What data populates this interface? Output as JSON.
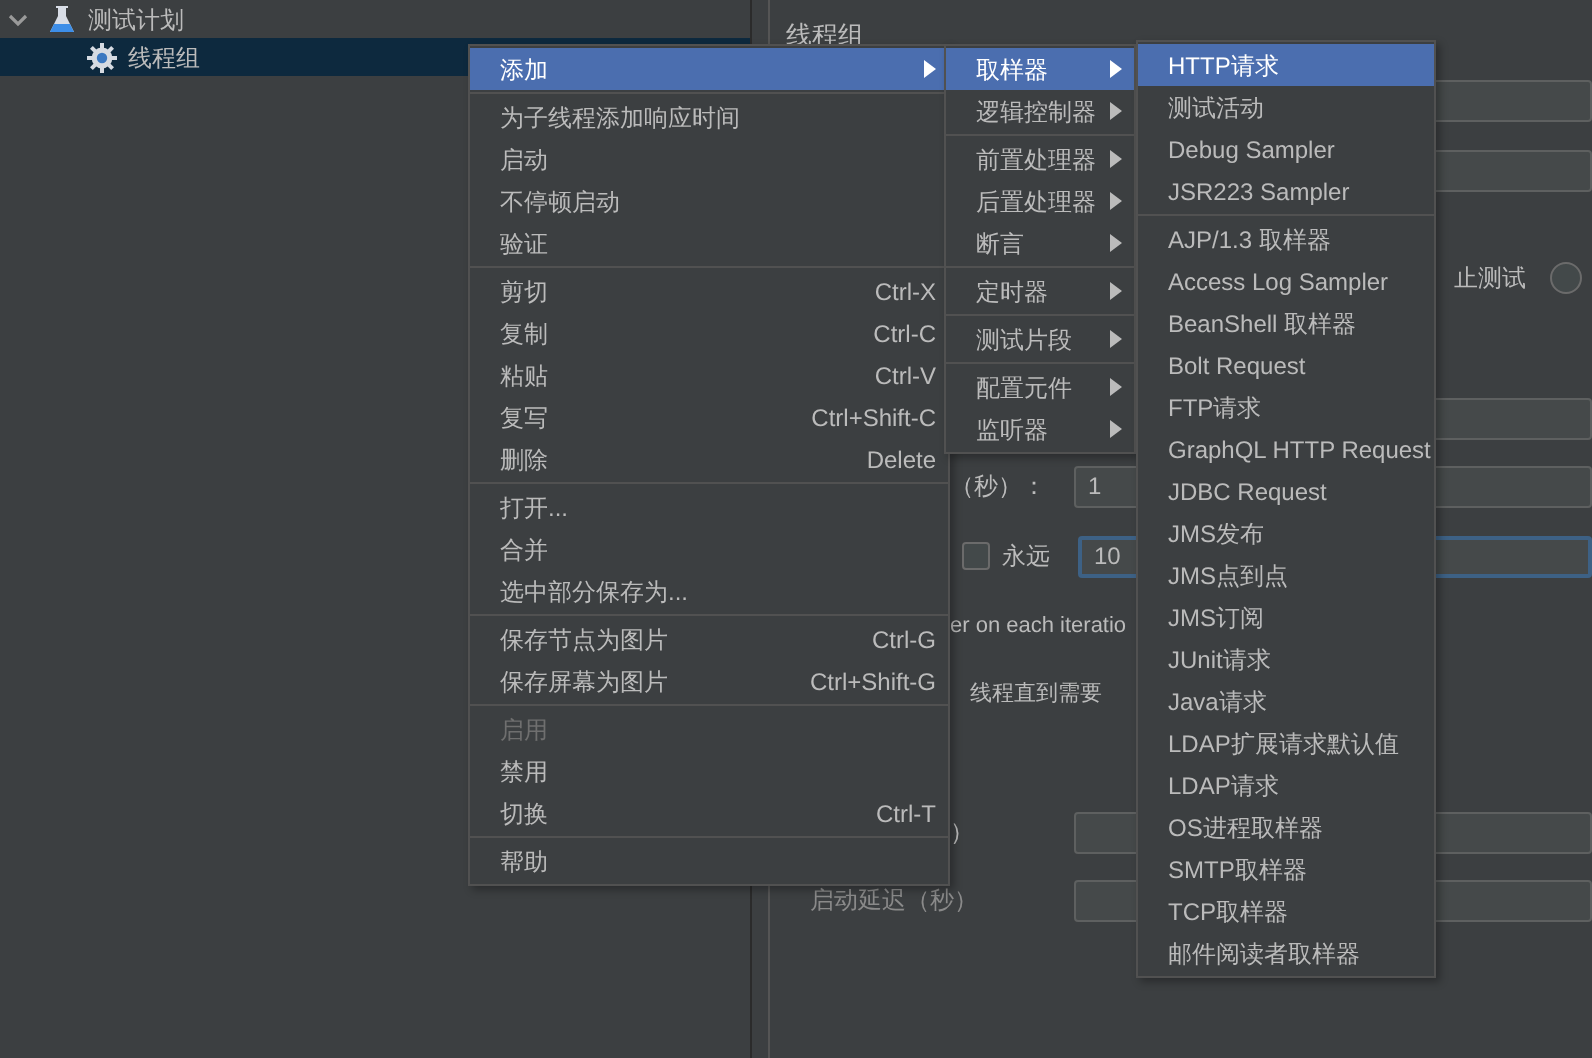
{
  "tree": [
    {
      "label": "测试计划",
      "kind": "test_plan",
      "expanded": true,
      "selected": false,
      "children": [
        {
          "label": "线程组",
          "kind": "thread_group",
          "selected": true
        }
      ]
    }
  ],
  "panel": {
    "title": "线程组",
    "rows": [
      {
        "kind": "field",
        "focused": false
      },
      {
        "kind": "field",
        "focused": false
      },
      {
        "kind": "radio",
        "text": "止测试",
        "checked": false
      },
      {
        "kind": "field",
        "focused": false
      },
      {
        "kind": "label_field",
        "label": "（秒）：",
        "value": "1",
        "focused": false
      },
      {
        "kind": "checkbox_field",
        "label": "永远",
        "checked": false,
        "value": "10",
        "focused": true
      },
      {
        "kind": "text",
        "text": "er on each iteratio"
      },
      {
        "kind": "text",
        "text": "线程直到需要"
      },
      {
        "kind": "label_field",
        "label": "）",
        "focused": false
      },
      {
        "kind": "label_field",
        "label": "启动延迟（秒）",
        "focused": false
      }
    ]
  },
  "context_menu": [
    {
      "kind": "item",
      "label": "添加",
      "submenu": true,
      "selected": true,
      "disabled": false
    },
    {
      "kind": "separator"
    },
    {
      "kind": "item",
      "label": "为子线程添加响应时间",
      "selected": false,
      "disabled": false
    },
    {
      "kind": "item",
      "label": "启动",
      "selected": false,
      "disabled": false
    },
    {
      "kind": "item",
      "label": "不停顿启动",
      "selected": false,
      "disabled": false
    },
    {
      "kind": "item",
      "label": "验证",
      "selected": false,
      "disabled": false
    },
    {
      "kind": "separator"
    },
    {
      "kind": "item",
      "label": "剪切",
      "shortcut": "Ctrl-X",
      "selected": false,
      "disabled": false
    },
    {
      "kind": "item",
      "label": "复制",
      "shortcut": "Ctrl-C",
      "selected": false,
      "disabled": false
    },
    {
      "kind": "item",
      "label": "粘贴",
      "shortcut": "Ctrl-V",
      "selected": false,
      "disabled": false
    },
    {
      "kind": "item",
      "label": "复写",
      "shortcut": "Ctrl+Shift-C",
      "selected": false,
      "disabled": false
    },
    {
      "kind": "item",
      "label": "删除",
      "shortcut": "Delete",
      "selected": false,
      "disabled": false
    },
    {
      "kind": "separator"
    },
    {
      "kind": "item",
      "label": "打开...",
      "selected": false,
      "disabled": false
    },
    {
      "kind": "item",
      "label": "合并",
      "selected": false,
      "disabled": false
    },
    {
      "kind": "item",
      "label": "选中部分保存为...",
      "selected": false,
      "disabled": false
    },
    {
      "kind": "separator"
    },
    {
      "kind": "item",
      "label": "保存节点为图片",
      "shortcut": "Ctrl-G",
      "selected": false,
      "disabled": false
    },
    {
      "kind": "item",
      "label": "保存屏幕为图片",
      "shortcut": "Ctrl+Shift-G",
      "selected": false,
      "disabled": false
    },
    {
      "kind": "separator"
    },
    {
      "kind": "item",
      "label": "启用",
      "selected": false,
      "disabled": true
    },
    {
      "kind": "item",
      "label": "禁用",
      "selected": false,
      "disabled": false
    },
    {
      "kind": "item",
      "label": "切换",
      "shortcut": "Ctrl-T",
      "selected": false,
      "disabled": false
    },
    {
      "kind": "separator"
    },
    {
      "kind": "item",
      "label": "帮助",
      "selected": false,
      "disabled": false
    }
  ],
  "add_menu": [
    {
      "kind": "item",
      "label": "取样器",
      "submenu": true,
      "selected": true
    },
    {
      "kind": "item",
      "label": "逻辑控制器",
      "submenu": true,
      "selected": false
    },
    {
      "kind": "separator"
    },
    {
      "kind": "item",
      "label": "前置处理器",
      "submenu": true,
      "selected": false
    },
    {
      "kind": "item",
      "label": "后置处理器",
      "submenu": true,
      "selected": false
    },
    {
      "kind": "item",
      "label": "断言",
      "submenu": true,
      "selected": false
    },
    {
      "kind": "separator"
    },
    {
      "kind": "item",
      "label": "定时器",
      "submenu": true,
      "selected": false
    },
    {
      "kind": "separator"
    },
    {
      "kind": "item",
      "label": "测试片段",
      "submenu": true,
      "selected": false
    },
    {
      "kind": "separator"
    },
    {
      "kind": "item",
      "label": "配置元件",
      "submenu": true,
      "selected": false
    },
    {
      "kind": "item",
      "label": "监听器",
      "submenu": true,
      "selected": false
    }
  ],
  "sampler_menu": [
    {
      "kind": "item",
      "label": "HTTP请求",
      "selected": true
    },
    {
      "kind": "item",
      "label": "测试活动",
      "selected": false
    },
    {
      "kind": "item",
      "label": "Debug Sampler",
      "selected": false
    },
    {
      "kind": "item",
      "label": "JSR223 Sampler",
      "selected": false
    },
    {
      "kind": "separator"
    },
    {
      "kind": "item",
      "label": "AJP/1.3 取样器",
      "selected": false
    },
    {
      "kind": "item",
      "label": "Access Log Sampler",
      "selected": false
    },
    {
      "kind": "item",
      "label": "BeanShell 取样器",
      "selected": false
    },
    {
      "kind": "item",
      "label": "Bolt Request",
      "selected": false
    },
    {
      "kind": "item",
      "label": "FTP请求",
      "selected": false
    },
    {
      "kind": "item",
      "label": "GraphQL HTTP Request",
      "selected": false
    },
    {
      "kind": "item",
      "label": "JDBC Request",
      "selected": false
    },
    {
      "kind": "item",
      "label": "JMS发布",
      "selected": false
    },
    {
      "kind": "item",
      "label": "JMS点到点",
      "selected": false
    },
    {
      "kind": "item",
      "label": "JMS订阅",
      "selected": false
    },
    {
      "kind": "item",
      "label": "JUnit请求",
      "selected": false
    },
    {
      "kind": "item",
      "label": "Java请求",
      "selected": false
    },
    {
      "kind": "item",
      "label": "LDAP扩展请求默认值",
      "selected": false
    },
    {
      "kind": "item",
      "label": "LDAP请求",
      "selected": false
    },
    {
      "kind": "item",
      "label": "OS进程取样器",
      "selected": false
    },
    {
      "kind": "item",
      "label": "SMTP取样器",
      "selected": false
    },
    {
      "kind": "item",
      "label": "TCP取样器",
      "selected": false
    },
    {
      "kind": "item",
      "label": "邮件阅读者取样器",
      "selected": false
    }
  ]
}
